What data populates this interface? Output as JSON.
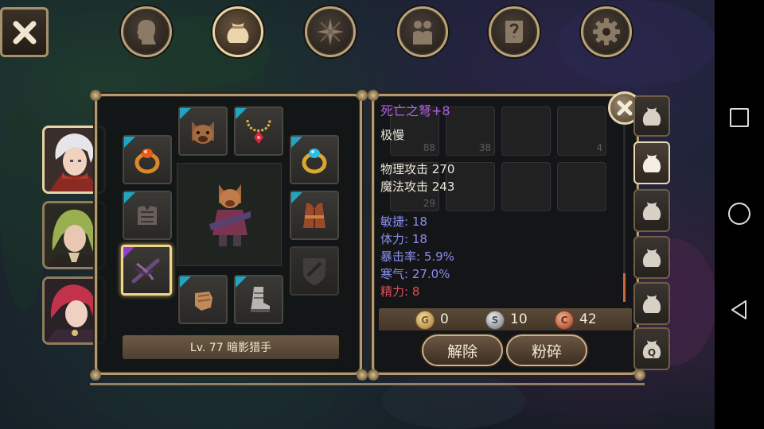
{
  "top_nav": {
    "close_icon": "close-x-icon",
    "tabs": [
      {
        "name": "character",
        "icon": "head-silhouette-icon"
      },
      {
        "name": "inventory",
        "icon": "bag-icon",
        "active": true
      },
      {
        "name": "skills",
        "icon": "compass-star-icon"
      },
      {
        "name": "party",
        "icon": "people-icon"
      },
      {
        "name": "quests",
        "icon": "scroll-icon"
      },
      {
        "name": "settings",
        "icon": "gear-icon"
      }
    ]
  },
  "characters": [
    {
      "name": "white-haired-hero",
      "active": true
    },
    {
      "name": "green-haired-hero",
      "active": false
    },
    {
      "name": "red-haired-hero",
      "active": false
    }
  ],
  "equipment": {
    "character_label": "Lv. 77 暗影猎手",
    "slots": [
      {
        "slot": "ring-left",
        "icon": "orange-ring-icon",
        "rarity": "blue"
      },
      {
        "slot": "helmet",
        "icon": "bear-helmet-icon",
        "rarity": "blue"
      },
      {
        "slot": "necklace",
        "icon": "ruby-necklace-icon",
        "rarity": "blue"
      },
      {
        "slot": "ring-right",
        "icon": "sapphire-ring-icon",
        "rarity": "blue"
      },
      {
        "slot": "shoulders",
        "icon": "armor-pauldron-icon",
        "rarity": "blue"
      },
      {
        "slot": "chest",
        "icon": "red-vest-icon",
        "rarity": "blue"
      },
      {
        "slot": "weapon",
        "icon": "crossbow-icon",
        "rarity": "purple",
        "selected": true
      },
      {
        "slot": "offhand",
        "icon": "shield-placeholder-icon",
        "rarity": "none"
      },
      {
        "slot": "gloves",
        "icon": "glove-icon",
        "rarity": "blue"
      },
      {
        "slot": "boots",
        "icon": "boot-icon",
        "rarity": "blue"
      }
    ]
  },
  "item_info": {
    "name": "死亡之弩+8",
    "speed": "极慢",
    "phys_attack": "物理攻击 270",
    "magic_attack": "魔法攻击 243",
    "stats": [
      {
        "text": "敏捷: 18",
        "color": "blue"
      },
      {
        "text": "体力: 18",
        "color": "blue"
      },
      {
        "text": "暴击率: 5.9%",
        "color": "blue"
      },
      {
        "text": "寒气: 27.0%",
        "color": "blue"
      },
      {
        "text": "精力: 8",
        "color": "red"
      }
    ],
    "background_item_counts": [
      "88",
      "38",
      "4",
      "29"
    ]
  },
  "currency": {
    "gold": "0",
    "silver": "10",
    "copper": "42",
    "gold_label": "G",
    "silver_label": "S",
    "copper_label": "C"
  },
  "actions": {
    "unequip_label": "解除",
    "shatter_label": "粉碎"
  },
  "bag_tabs": [
    {
      "active": false
    },
    {
      "active": true
    },
    {
      "active": false
    },
    {
      "active": false
    },
    {
      "active": false
    },
    {
      "active": false,
      "label": "Q"
    }
  ],
  "colors": {
    "item_name_purple": "#b05ee8",
    "stat_blue": "#8c8ef0",
    "stat_red": "#e0505a",
    "frame_gold": "#b09a74"
  }
}
